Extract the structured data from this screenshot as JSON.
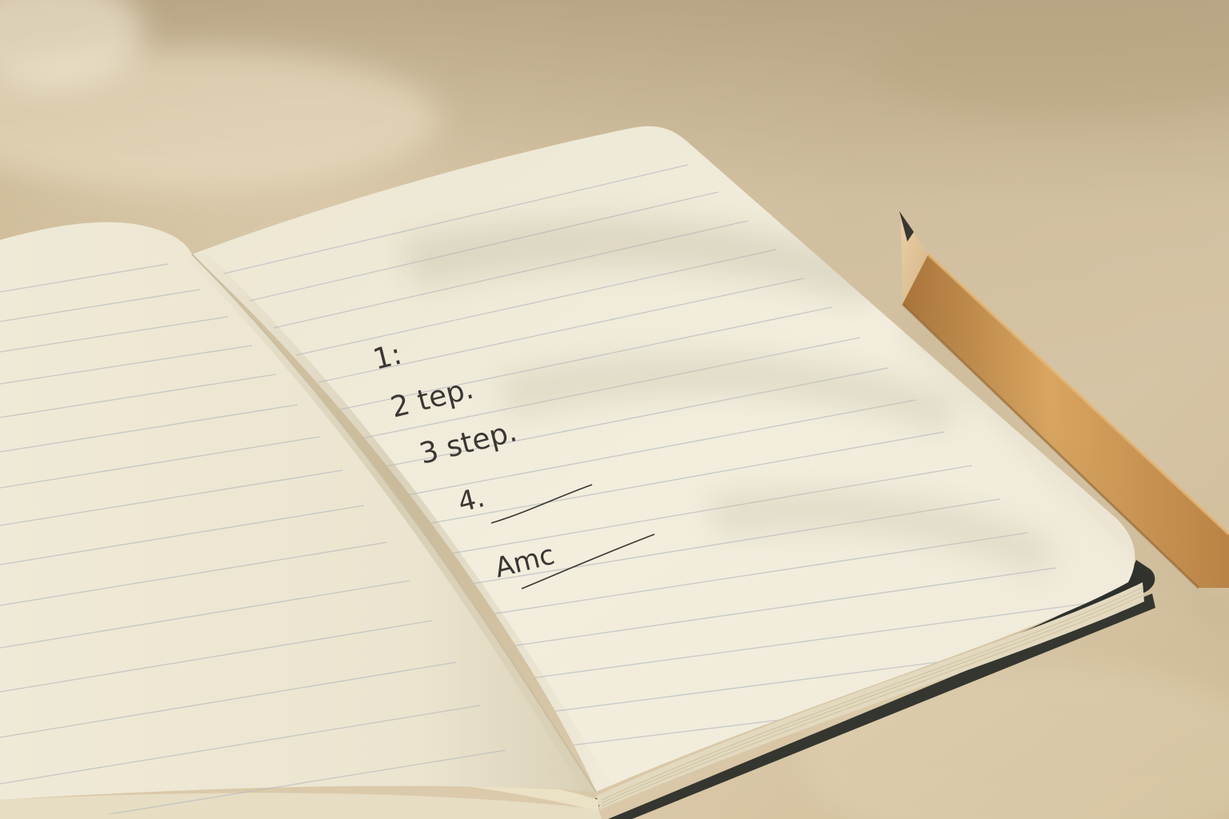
{
  "scene": {
    "subject": "open notebook with pencil",
    "handwriting": {
      "line1": "1:",
      "line2": "2 tep.",
      "line3": "3 step.",
      "line4": "4.",
      "line5": "Amc"
    },
    "colors": {
      "desk": "#d9c9a8",
      "page": "#f1ecdc",
      "ink": "#3a3632",
      "cover": "#2e302c",
      "pencil": "#c9924f"
    }
  }
}
